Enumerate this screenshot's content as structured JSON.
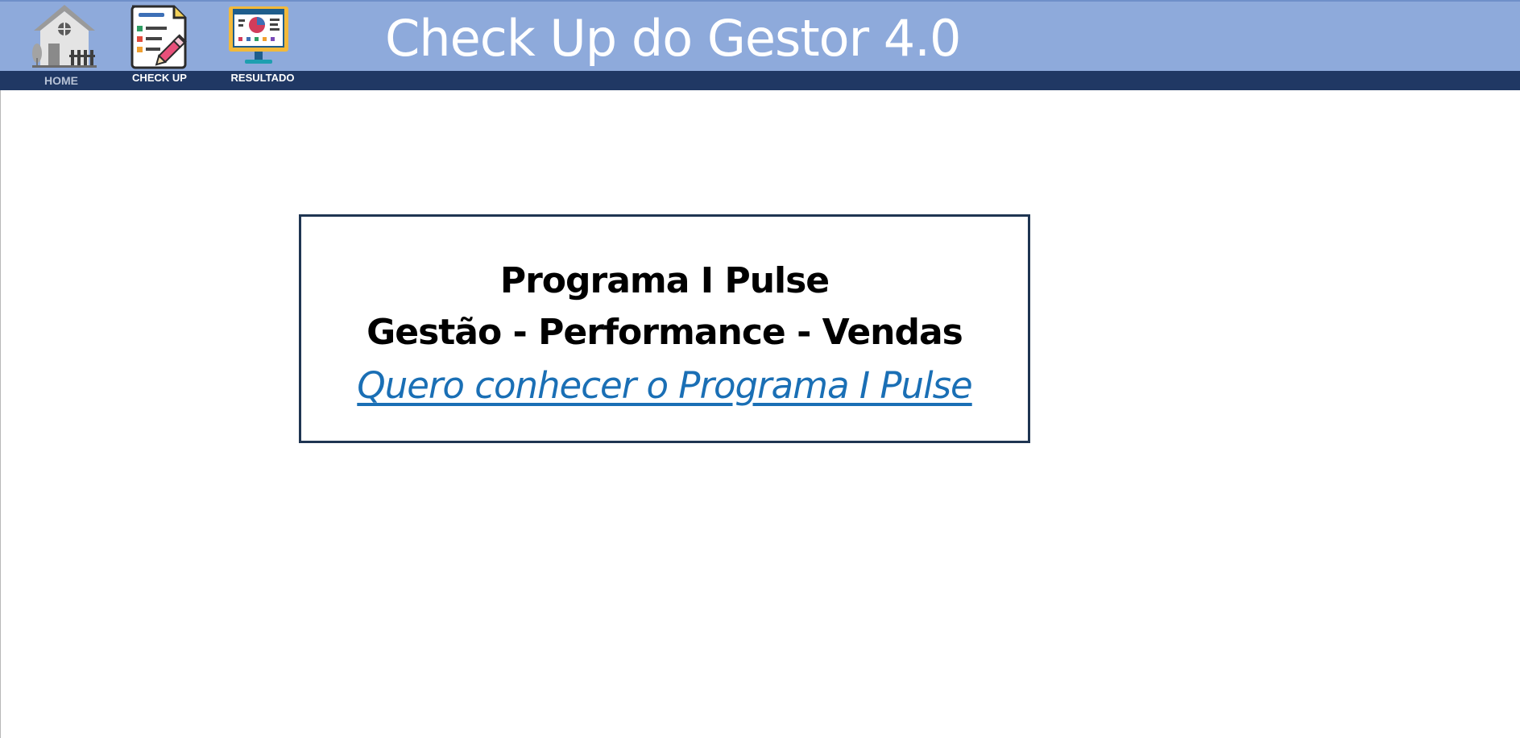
{
  "app": {
    "title": "Check Up do Gestor 4.0"
  },
  "nav": {
    "items": [
      {
        "label": "HOME",
        "icon": "house-icon",
        "active": true
      },
      {
        "label": "CHECK UP",
        "icon": "checklist-pencil-icon",
        "active": false
      },
      {
        "label": "RESULTADO",
        "icon": "monitor-chart-icon",
        "active": false
      }
    ]
  },
  "promo": {
    "title": "Programa I Pulse",
    "subtitle": "Gestão - Performance - Vendas",
    "link_text": "Quero conhecer o Programa I Pulse"
  },
  "colors": {
    "header_bg": "#8eaadb",
    "nav_strip_bg": "#203864",
    "box_border": "#1f3552",
    "link": "#1a6fb5"
  }
}
